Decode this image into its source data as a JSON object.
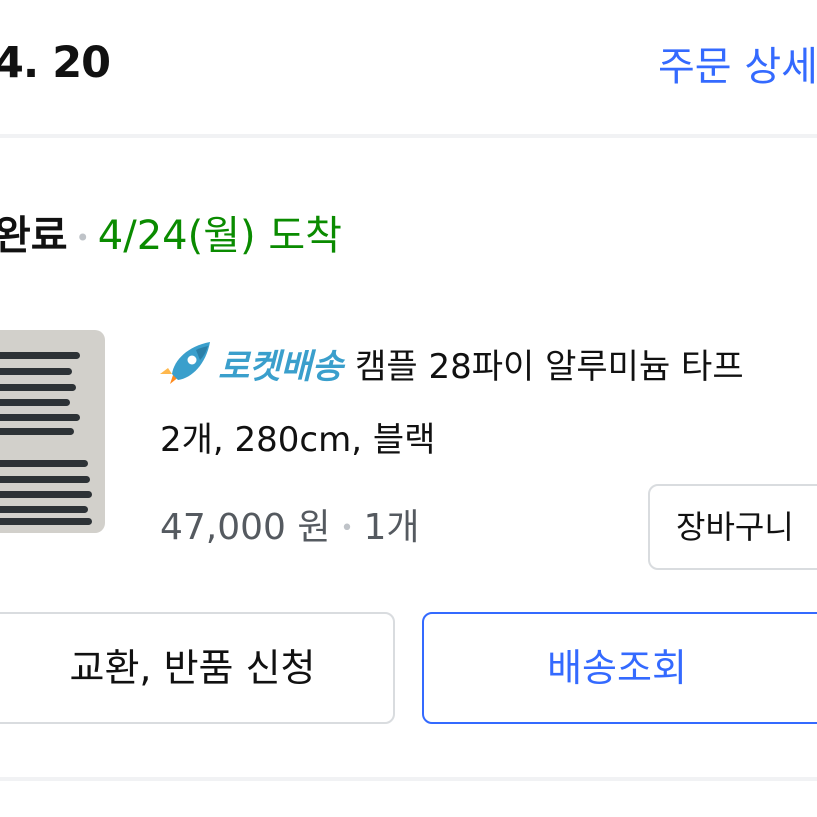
{
  "header": {
    "order_date": "4. 20",
    "order_detail_link": "주문 상세"
  },
  "shipment": {
    "status": "완료",
    "arrival": "4/24(월) 도착"
  },
  "product": {
    "rocket_label": "로켓배송",
    "name_line1": "캠플 28파이 알루미늄 타프",
    "name_line2": "2개, 280cm, 블랙",
    "price": "47,000 원",
    "quantity": "1개",
    "image_description_icon": "black-aluminum-poles-image"
  },
  "actions": {
    "cart_label": "장바구니",
    "exchange_label": "교환, 반품 신청",
    "tracking_label": "배송조회"
  },
  "colors": {
    "accent_blue": "#346aff",
    "arrival_green": "#0a8b00",
    "rocket_teal": "#3a9fcc"
  }
}
